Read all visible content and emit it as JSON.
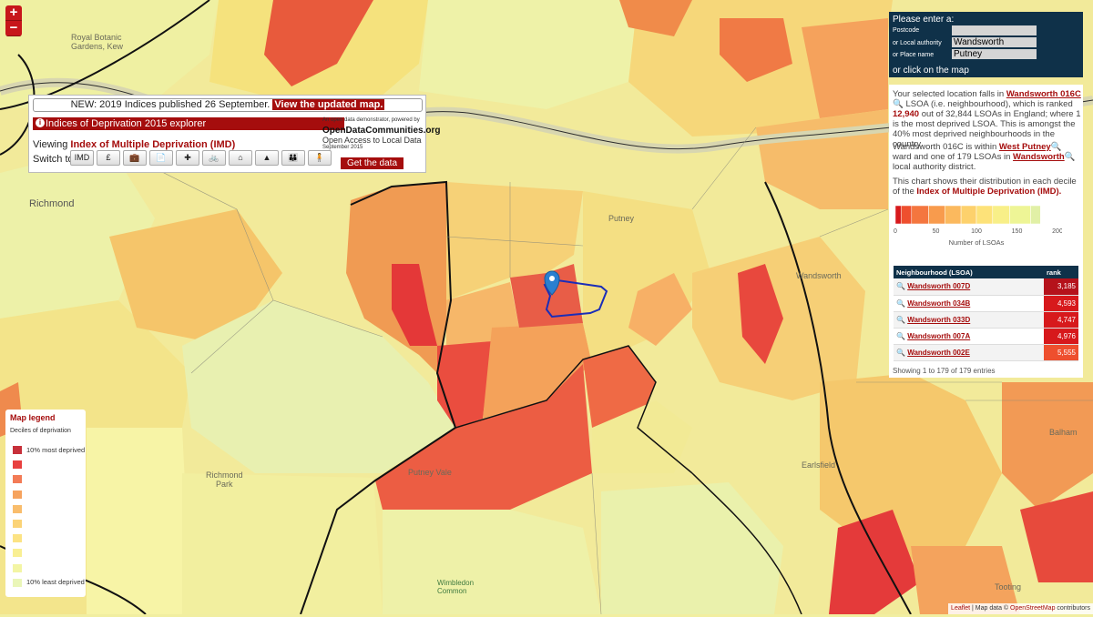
{
  "zoom": {
    "in": "+",
    "out": "−"
  },
  "places": [
    {
      "name": "Royal Botanic\nGardens, Kew"
    },
    {
      "name": "Richmond"
    },
    {
      "name": "Richmond\nPark"
    },
    {
      "name": "Putney Vale"
    },
    {
      "name": "Wimbledon\nCommon"
    },
    {
      "name": "Putney"
    },
    {
      "name": "Wandsworth"
    },
    {
      "name": "Balham"
    },
    {
      "name": "Earlsfield"
    },
    {
      "name": "Tooting"
    }
  ],
  "explorer": {
    "news_prefix": "NEW: 2019 Indices published 26 September.",
    "news_link": "View the updated map.",
    "title": "Indices of Deprivation 2015 explorer",
    "viewing_label": "Viewing",
    "viewing_value": "Index of Multiple Deprivation (IMD)",
    "switch_label": "Switch to:",
    "switch_buttons": [
      "IMD",
      "£",
      "💼",
      "📄",
      "✚",
      "🚲",
      "⌂",
      "▲",
      "👪",
      "🧍"
    ],
    "odc_line1": "An open data demonstrator, powered by",
    "odc_name": "OpenDataCommunities.org",
    "odc_tag": "Open Access to Local Data",
    "odc_date": "September 2015",
    "get_data": "Get the data"
  },
  "search": {
    "title": "Please enter a:",
    "postcode_label": "Postcode",
    "postcode_value": "",
    "la_label": "or Local authority",
    "la_value": "Wandsworth",
    "place_label": "or Place name",
    "place_value": "Putney",
    "click_hint": "or click on the map"
  },
  "info": {
    "p1_a": "Your selected location falls in",
    "p1_lsoa": "Wandsworth 016C",
    "p1_b": "LSOA (i.e. neighbourhood), which is ranked",
    "p1_rank": "12,940",
    "p1_c": "out of 32,844 LSOAs in England; where 1 is the most deprived LSOA. This is amongst the 40% most deprived neighbourhoods in the country.",
    "p2_a": "Wandsworth 016C is within",
    "p2_ward": "West Putney",
    "p2_b": "ward and one of 179 LSOAs in",
    "p2_la": "Wandsworth",
    "p2_c": "local authority district.",
    "p3_a": "This chart shows their distribution in each decile of the",
    "p3_idx": "Index of Multiple Deprivation (IMD).",
    "chart_xlabel": "Number of LSOAs",
    "table_head_name": "Neighbourhood (LSOA)",
    "table_head_rank": "rank",
    "rows": [
      {
        "name": "Wandsworth 007D",
        "rank": "3,185",
        "color": "#b5121b"
      },
      {
        "name": "Wandsworth 034B",
        "rank": "4,593",
        "color": "#d7191c"
      },
      {
        "name": "Wandsworth 033D",
        "rank": "4,747",
        "color": "#d7191c"
      },
      {
        "name": "Wandsworth 007A",
        "rank": "4,976",
        "color": "#d7191c"
      },
      {
        "name": "Wandsworth 002E",
        "rank": "5,555",
        "color": "#ee4f2e"
      }
    ],
    "showing": "Showing 1 to 179 of 179 entries"
  },
  "chart_data": {
    "type": "bar",
    "orientation": "horizontal-stacked",
    "xlabel": "Number of LSOAs",
    "xlim": [
      0,
      200
    ],
    "ticks": [
      0,
      50,
      100,
      150,
      200
    ],
    "categories": [
      "1",
      "2",
      "3",
      "4",
      "5",
      "6",
      "7",
      "8",
      "9",
      "10"
    ],
    "values": [
      7,
      13,
      21,
      20,
      20,
      19,
      20,
      21,
      26,
      12
    ],
    "colors": [
      "#d7191c",
      "#ee4f2e",
      "#f4763f",
      "#f89b4d",
      "#fbb95e",
      "#fdd16c",
      "#fde279",
      "#f8ef88",
      "#eef596",
      "#e1f0a6"
    ]
  },
  "legend": {
    "title": "Map legend",
    "subtitle": "Deciles of deprivation",
    "top_label": "10% most deprived",
    "bottom_label": "10% least deprived",
    "colors": [
      "#c7303a",
      "#e8403f",
      "#f37b56",
      "#f6a35e",
      "#f9bd6c",
      "#fbd377",
      "#fce384",
      "#f9ef93",
      "#f3f5a4",
      "#eaf6b8"
    ]
  },
  "attribution": {
    "leaflet": "Leaflet",
    "mid": "| Map data ©",
    "osm": "OpenStreetMap",
    "end": "contributors"
  }
}
